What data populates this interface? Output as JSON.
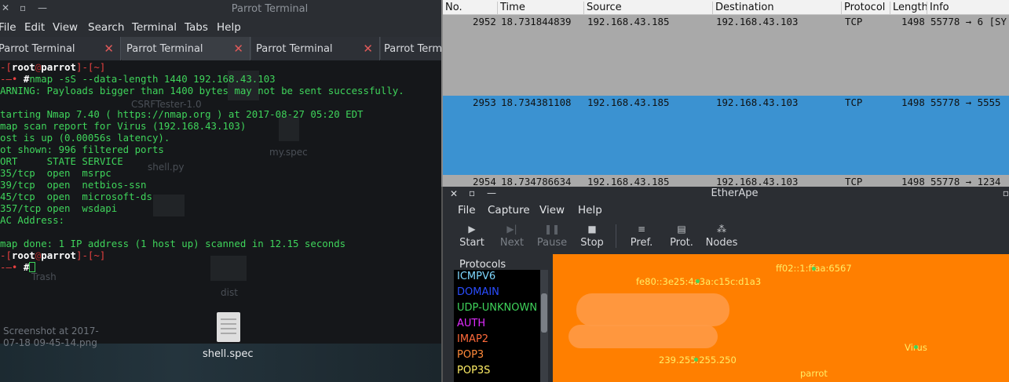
{
  "terminal": {
    "title": "Parrot Terminal",
    "menu": [
      "File",
      "Edit",
      "View",
      "Search",
      "Terminal",
      "Tabs",
      "Help"
    ],
    "tabs": [
      "Parrot Terminal",
      "Parrot Terminal",
      "Parrot Terminal",
      "Parrot Termi"
    ],
    "prompt_open": "-[",
    "prompt_user": "root",
    "prompt_at": "@",
    "prompt_host": "parrot",
    "prompt_close": "]-[~]",
    "prompt_arrow": "-—• ",
    "prompt_hash": "#",
    "command": "nmap -sS --data-length 1440 192.168.43.103",
    "lines": [
      "ARNING: Payloads bigger than 1400 bytes may not be sent successfully.",
      "",
      "tarting Nmap 7.40 ( https://nmap.org ) at 2017-08-27 05:20 EDT",
      "map scan report for Virus (192.168.43.103)",
      "ost is up (0.00056s latency).",
      "ot shown: 996 filtered ports",
      "ORT     STATE SERVICE",
      "35/tcp  open  msrpc",
      "39/tcp  open  netbios-ssn",
      "45/tcp  open  microsoft-ds",
      "357/tcp open  wsdapi",
      "AC Address:",
      "",
      "map done: 1 IP address (1 host up) scanned in 12.15 seconds"
    ],
    "desktop": {
      "ghost_labels": [
        "CSRFTester-1.0",
        "my.spec",
        "shell.py",
        "Trash",
        "dist"
      ],
      "screenshot_label": [
        "Screenshot at 2017-",
        "07-18 09-45-14.png"
      ],
      "file_label": "shell.spec"
    }
  },
  "wireshark": {
    "columns": [
      "No.",
      "Time",
      "Source",
      "Destination",
      "Protocol",
      "Length",
      "Info"
    ],
    "rows": [
      {
        "no": "2952",
        "time": "18.731844839",
        "source": "192.168.43.185",
        "destination": "192.168.43.103",
        "protocol": "TCP",
        "length": "1498",
        "info": "55778 → 6 [SY",
        "selected": false
      },
      {
        "no": "2953",
        "time": "18.734381108",
        "source": "192.168.43.185",
        "destination": "192.168.43.103",
        "protocol": "TCP",
        "length": "1498",
        "info": "55778 → 5555",
        "selected": true
      },
      {
        "no": "2954",
        "time": "18.734786634",
        "source": "192.168.43.185",
        "destination": "192.168.43.103",
        "protocol": "TCP",
        "length": "1498",
        "info": "55778 → 1234",
        "selected": false
      }
    ],
    "colors": {
      "row_gray": "#a9a9a9",
      "row_selected": "#3b92d1"
    }
  },
  "etherape": {
    "title": "EtherApe",
    "menu": [
      "File",
      "Capture",
      "View",
      "Help"
    ],
    "toolbar": [
      {
        "label": "Start",
        "icon": "play-icon",
        "glyph": "▶",
        "enabled": true
      },
      {
        "label": "Next",
        "icon": "skip-next-icon",
        "glyph": "▶|",
        "enabled": false
      },
      {
        "label": "Pause",
        "icon": "pause-icon",
        "glyph": "❚❚",
        "enabled": false
      },
      {
        "label": "Stop",
        "icon": "stop-icon",
        "glyph": "■",
        "enabled": true
      },
      {
        "label": "Pref.",
        "icon": "preferences-icon",
        "glyph": "≡",
        "enabled": true
      },
      {
        "label": "Prot.",
        "icon": "protocols-icon",
        "glyph": "▤",
        "enabled": true
      },
      {
        "label": "Nodes",
        "icon": "nodes-icon",
        "glyph": "⁂",
        "enabled": true
      }
    ],
    "protocols_label": "Protocols",
    "protocols": [
      {
        "name": "ICMPV6",
        "color": "#7fd8ff"
      },
      {
        "name": "DOMAIN",
        "color": "#2a4dff"
      },
      {
        "name": "UDP-UNKNOWN",
        "color": "#3fd45b"
      },
      {
        "name": "AUTH",
        "color": "#e02cff"
      },
      {
        "name": "IMAP2",
        "color": "#ff6a3a"
      },
      {
        "name": "POP3",
        "color": "#ff8a3a"
      },
      {
        "name": "POP3S",
        "color": "#ffee66"
      }
    ],
    "nodes": [
      "ff02::1:ffaa:6567",
      "fe80::3e25:4a3a:c15c:d1a3",
      "Virus",
      "239.255.255.250",
      "parrot"
    ],
    "canvas_color": "#ff7f00"
  }
}
